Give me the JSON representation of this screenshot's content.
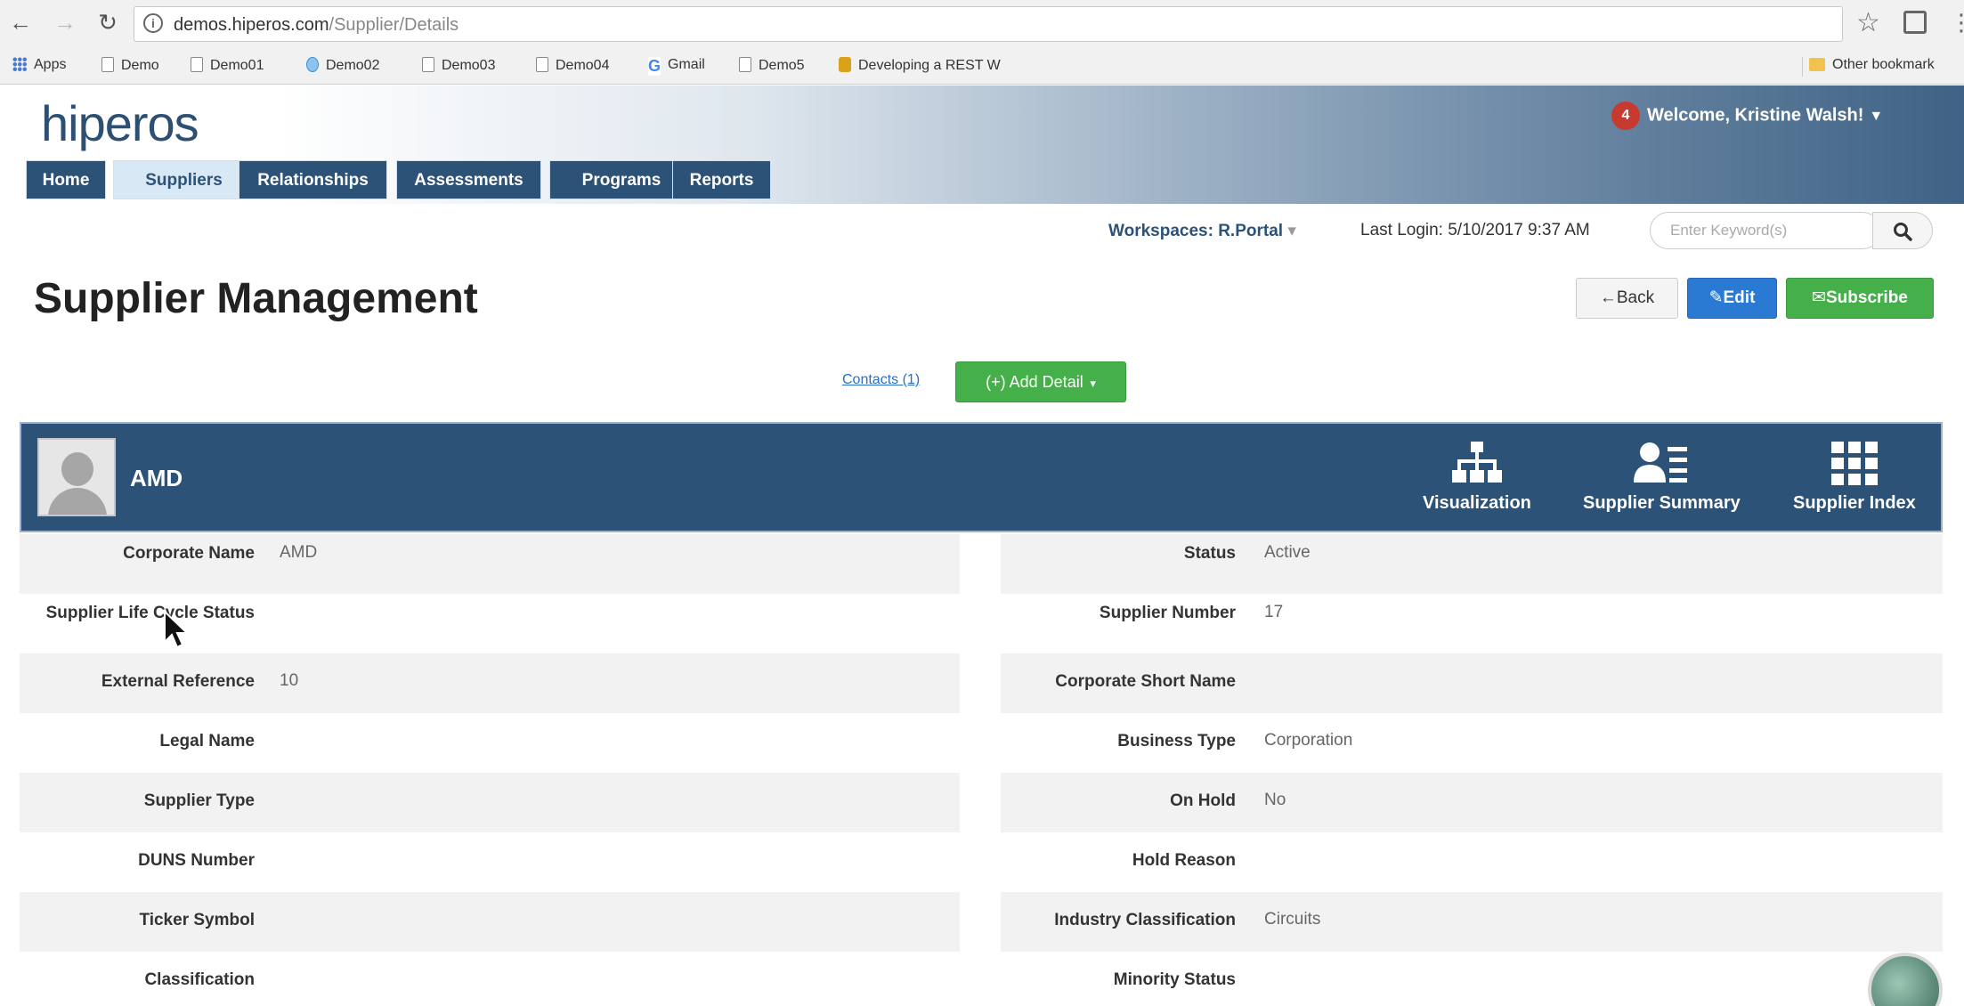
{
  "browser": {
    "url_host": "demos.hiperos.com",
    "url_path": "/Supplier/Details",
    "bookmarks": [
      "Apps",
      "Demo",
      "Demo01",
      "Demo02",
      "Demo03",
      "Demo04",
      "Gmail",
      "Demo5",
      "Developing a REST W"
    ],
    "other_bookmarks": "Other bookmark"
  },
  "header": {
    "logo": "hiperos",
    "notification_count": "4",
    "welcome": "Welcome, Kristine Walsh!",
    "tabs": [
      "Home",
      "Suppliers",
      "Relationships",
      "Assessments",
      "Programs",
      "Reports"
    ],
    "active_tab": "Suppliers"
  },
  "utility": {
    "workspaces": "Workspaces: R.Portal",
    "last_login": "Last Login: 5/10/2017 9:37 AM",
    "search_placeholder": "Enter Keyword(s)"
  },
  "page": {
    "title": "Supplier Management",
    "back": "←Back",
    "edit": "✎Edit",
    "subscribe": "✉Subscribe",
    "contacts": "Contacts (1)",
    "add_detail": "(+) Add Detail"
  },
  "supplier": {
    "name": "AMD",
    "actions": [
      "Visualization",
      "Supplier Summary",
      "Supplier Index"
    ]
  },
  "details_left": [
    {
      "label": "Corporate Name",
      "value": "AMD"
    },
    {
      "label": "Supplier Life Cycle Status",
      "value": ""
    },
    {
      "label": "External Reference",
      "value": "10"
    },
    {
      "label": "Legal Name",
      "value": ""
    },
    {
      "label": "Supplier Type",
      "value": ""
    },
    {
      "label": "DUNS Number",
      "value": ""
    },
    {
      "label": "Ticker Symbol",
      "value": ""
    },
    {
      "label": "Classification",
      "value": ""
    }
  ],
  "details_right": [
    {
      "label": "Status",
      "value": "Active"
    },
    {
      "label": "Supplier Number",
      "value": "17"
    },
    {
      "label": "Corporate Short Name",
      "value": ""
    },
    {
      "label": "Business Type",
      "value": "Corporation"
    },
    {
      "label": "On Hold",
      "value": "No"
    },
    {
      "label": "Hold Reason",
      "value": ""
    },
    {
      "label": "Industry Classification",
      "value": "Circuits"
    },
    {
      "label": "Minority Status",
      "value": ""
    }
  ],
  "colors": {
    "primary_navy": "#2d5278",
    "edit_blue": "#2a7ad3",
    "success_green": "#45b04a",
    "badge_red": "#c73a30"
  }
}
